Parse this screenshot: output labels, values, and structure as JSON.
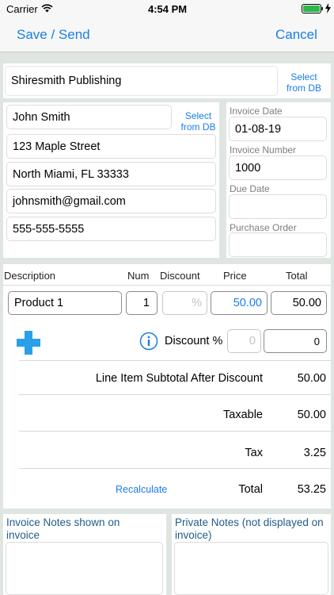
{
  "status": {
    "carrier": "Carrier",
    "time": "4:54 PM"
  },
  "nav": {
    "save_send": "Save / Send",
    "cancel": "Cancel"
  },
  "company": {
    "name": "Shiresmith Publishing",
    "select_db": "Select from DB"
  },
  "client": {
    "name": "John Smith",
    "select_db": "Select from DB",
    "address1": "123 Maple Street",
    "address2": "North Miami, FL  33333",
    "email": "johnsmith@gmail.com",
    "phone": "555-555-5555"
  },
  "invoice": {
    "date_label": "Invoice Date",
    "date_value": "01-08-19",
    "number_label": "Invoice Number",
    "number_value": "1000",
    "due_label": "Due Date",
    "due_value": "",
    "po_label": "Purchase Order",
    "po_value": ""
  },
  "line_items": {
    "headers": {
      "description": "Description",
      "num": "Num",
      "discount": "Discount",
      "price": "Price",
      "total": "Total"
    },
    "rows": [
      {
        "description": "Product 1",
        "num": "1",
        "discount_placeholder": "%",
        "price": "50.00",
        "total": "50.00"
      }
    ]
  },
  "discount": {
    "label": "Discount %",
    "percent_placeholder": "0",
    "amount": "0"
  },
  "summary": {
    "subtotal_label": "Line Item Subtotal After Discount",
    "subtotal_value": "50.00",
    "taxable_label": "Taxable",
    "taxable_value": "50.00",
    "tax_label": "Tax",
    "tax_value": "3.25",
    "recalculate": "Recalculate",
    "total_label": "Total",
    "total_value": "53.25"
  },
  "notes": {
    "invoice_label": "Invoice Notes shown on invoice",
    "private_label": "Private Notes (not displayed on invoice)"
  },
  "colors": {
    "accent": "#1a7de8",
    "plus": "#2aa0e8",
    "background": "#dfe6e1",
    "notes_label": "#1f5d88"
  },
  "icons": {
    "wifi": "wifi-icon",
    "battery": "battery-icon",
    "charging": "bolt-icon",
    "add": "plus-icon",
    "info": "info-icon"
  }
}
